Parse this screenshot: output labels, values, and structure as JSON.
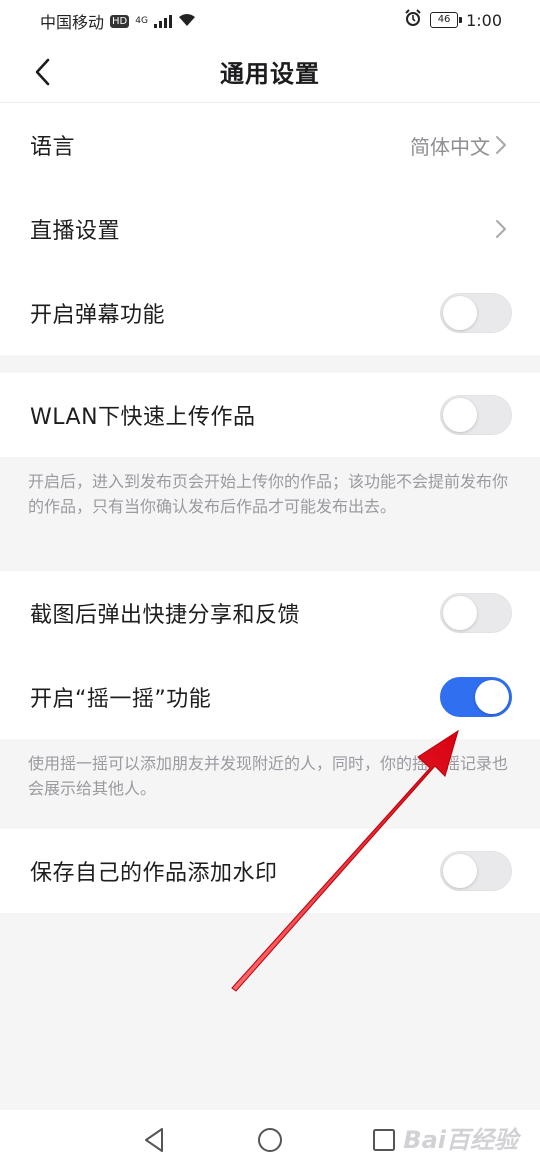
{
  "status_bar": {
    "carrier": "中国移动",
    "hd": "HD",
    "network": "4G",
    "battery": "46",
    "time": "1:00"
  },
  "header": {
    "title": "通用设置"
  },
  "settings": {
    "language": {
      "label": "语言",
      "value": "简体中文"
    },
    "live": {
      "label": "直播设置"
    },
    "danmaku": {
      "label": "开启弹幕功能",
      "on": false
    },
    "wlan_upload": {
      "label": "WLAN下快速上传作品",
      "on": false
    },
    "wlan_note": "开启后，进入到发布页会开始上传你的作品；该功能不会提前发布你的作品，只有当你确认发布后作品才可能发布出去。",
    "screenshot_share": {
      "label": "截图后弹出快捷分享和反馈",
      "on": false
    },
    "shake": {
      "label": "开启“摇一摇”功能",
      "on": true
    },
    "shake_note": "使用摇一摇可以添加朋友并发现附近的人，同时，你的摇一摇记录也会展示给其他人。",
    "watermark": {
      "label": "保存自己的作品添加水印",
      "on": false
    }
  },
  "colors": {
    "toggle_on": "#2f6ff0",
    "toggle_off": "#e9e9ec",
    "annotation_arrow": "#e8121d"
  },
  "overlay": {
    "watermark_text": "Bai百经验"
  }
}
